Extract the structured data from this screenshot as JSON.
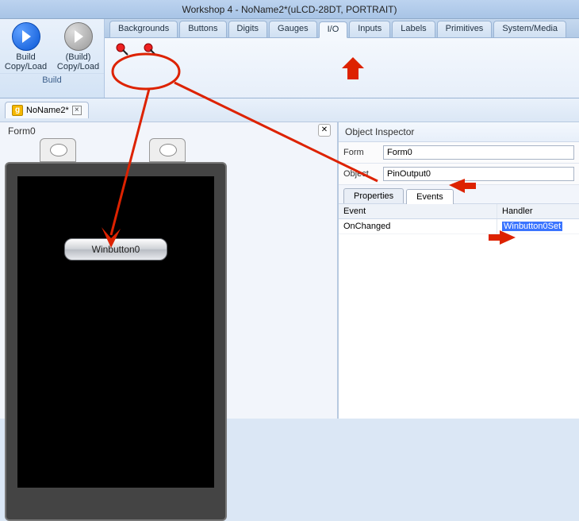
{
  "title": "Workshop 4 - NoName2*(uLCD-28DT, PORTRAIT)",
  "build": {
    "btn1_l1": "Build",
    "btn1_l2": "Copy/Load",
    "btn2_l1": "(Build)",
    "btn2_l2": "Copy/Load",
    "group": "Build"
  },
  "ribbon_tabs": [
    "Backgrounds",
    "Buttons",
    "Digits",
    "Gauges",
    "I/O",
    "Inputs",
    "Labels",
    "Primitives",
    "System/Media"
  ],
  "ribbon_active": "I/O",
  "file_tab": {
    "name": "NoName2*",
    "icon": "g"
  },
  "form": {
    "label": "Form0"
  },
  "winbutton": "Winbutton0",
  "inspector": {
    "title": "Object Inspector",
    "form_label": "Form",
    "form_value": "Form0",
    "object_label": "Object",
    "object_value": "PinOutput0",
    "tabs": [
      "Properties",
      "Events"
    ],
    "active_tab": "Events",
    "headers": [
      "Event",
      "Handler"
    ],
    "rows": [
      {
        "event": "OnChanged",
        "handler": "Winbutton0Set"
      }
    ]
  }
}
